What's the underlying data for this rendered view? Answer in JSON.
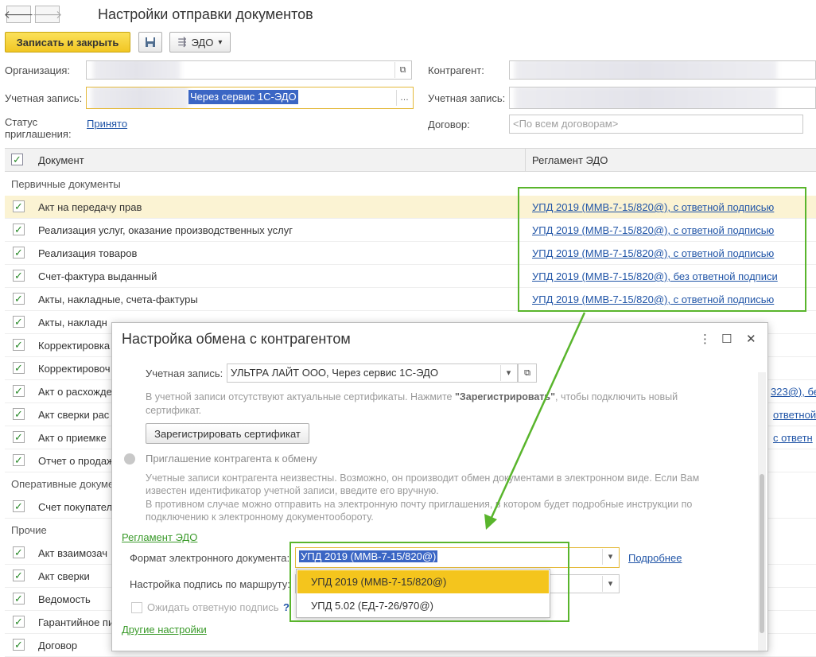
{
  "window": {
    "title": "Настройки отправки документов"
  },
  "toolbar": {
    "save_close": "Записать и закрыть",
    "edo_label": "ЭДО",
    "dropdown_arrow": "▾"
  },
  "form": {
    "org_label": "Организация:",
    "account_label": "Учетная запись:",
    "account_value": "Через сервис 1С-ЭДО",
    "invite_status_label": "Статус приглашения:",
    "invite_status_value": "Принято",
    "contractor_label": "Контрагент:",
    "contractor_account_label": "Учетная запись:",
    "contract_label": "Договор:",
    "contract_placeholder": "<По всем договорам>"
  },
  "table": {
    "col_document": "Документ",
    "col_regulation": "Регламент ЭДО",
    "groups": {
      "primary": "Первичные документы",
      "operative": "Оперативные докуме",
      "other": "Прочие"
    },
    "rows": [
      {
        "doc": "Акт на передачу прав",
        "reg": "УПД 2019 (ММВ-7-15/820@), с ответной подписью"
      },
      {
        "doc": "Реализация услуг, оказание производственных услуг",
        "reg": "УПД 2019 (ММВ-7-15/820@), с ответной подписью"
      },
      {
        "doc": "Реализация товаров",
        "reg": "УПД 2019 (ММВ-7-15/820@), с ответной подписью"
      },
      {
        "doc": "Счет-фактура выданный",
        "reg": "УПД 2019 (ММВ-7-15/820@), без ответной подписи"
      },
      {
        "doc": "Акты, накладные, счета-фактуры",
        "reg": "УПД 2019 (ММВ-7-15/820@), с ответной подписью"
      },
      {
        "doc": "Акты, накладн",
        "reg": ""
      },
      {
        "doc": "Корректировка",
        "reg": ""
      },
      {
        "doc": "Корректировоч",
        "reg": ""
      },
      {
        "doc": "Акт о расхожде",
        "reg": "323@), бе"
      },
      {
        "doc": "Акт сверки рас",
        "reg": "ответной"
      },
      {
        "doc": "Акт о приемке",
        "reg": "с ответн"
      },
      {
        "doc": "Отчет о продаж",
        "reg": ""
      },
      {
        "doc": "Счет покупател",
        "reg": ""
      },
      {
        "doc": "Акт взаимозач",
        "reg": ""
      },
      {
        "doc": "Акт сверки",
        "reg": ""
      },
      {
        "doc": "Ведомость",
        "reg": ""
      },
      {
        "doc": "Гарантийное пи",
        "reg": ""
      },
      {
        "doc": "Договор",
        "reg": ""
      }
    ],
    "check": "✓"
  },
  "dialog": {
    "title": "Настройка обмена с контрагентом",
    "account_label": "Учетная запись:",
    "account_value": "УЛЬТРА ЛАЙТ ООО, Через сервис 1С-ЭДО",
    "cert_notice_pre": "В учетной записи отсутствуют актуальные сертификаты. Нажмите ",
    "cert_notice_bold": "\"Зарегистрировать\"",
    "cert_notice_post": ", чтобы подключить новый сертификат.",
    "register_cert": "Зарегистрировать сертификат",
    "invite_label": "Приглашение контрагента к обмену",
    "invite_text_1": "Учетные записи контрагента неизвестны. Возможно, он производит обмен документами в электронном виде. Если Вам известен идентификатор учетной записи, введите его вручную.",
    "invite_text_2": "В противном случае можно отправить на электронную почту приглашения, в котором будет подробные инструкции по подключению к электронному документообороту.",
    "reglament_link": "Регламент ЭДО",
    "format_label": "Формат электронного документа:",
    "format_value": "УПД 2019 (ММВ-7-15/820@)",
    "details_link": "Подробнее",
    "route_label": "Настройка подпись по маршруту:",
    "await_label": "Ожидать ответную подпись",
    "help": "?",
    "other_settings": "Другие настройки",
    "options": [
      "УПД 2019 (ММВ-7-15/820@)",
      "УПД 5.02 (ЕД-7-26/970@)"
    ]
  },
  "colors": {
    "accent_green": "#59b52c",
    "link": "#2155a7",
    "highlight": "#f4c51d"
  }
}
